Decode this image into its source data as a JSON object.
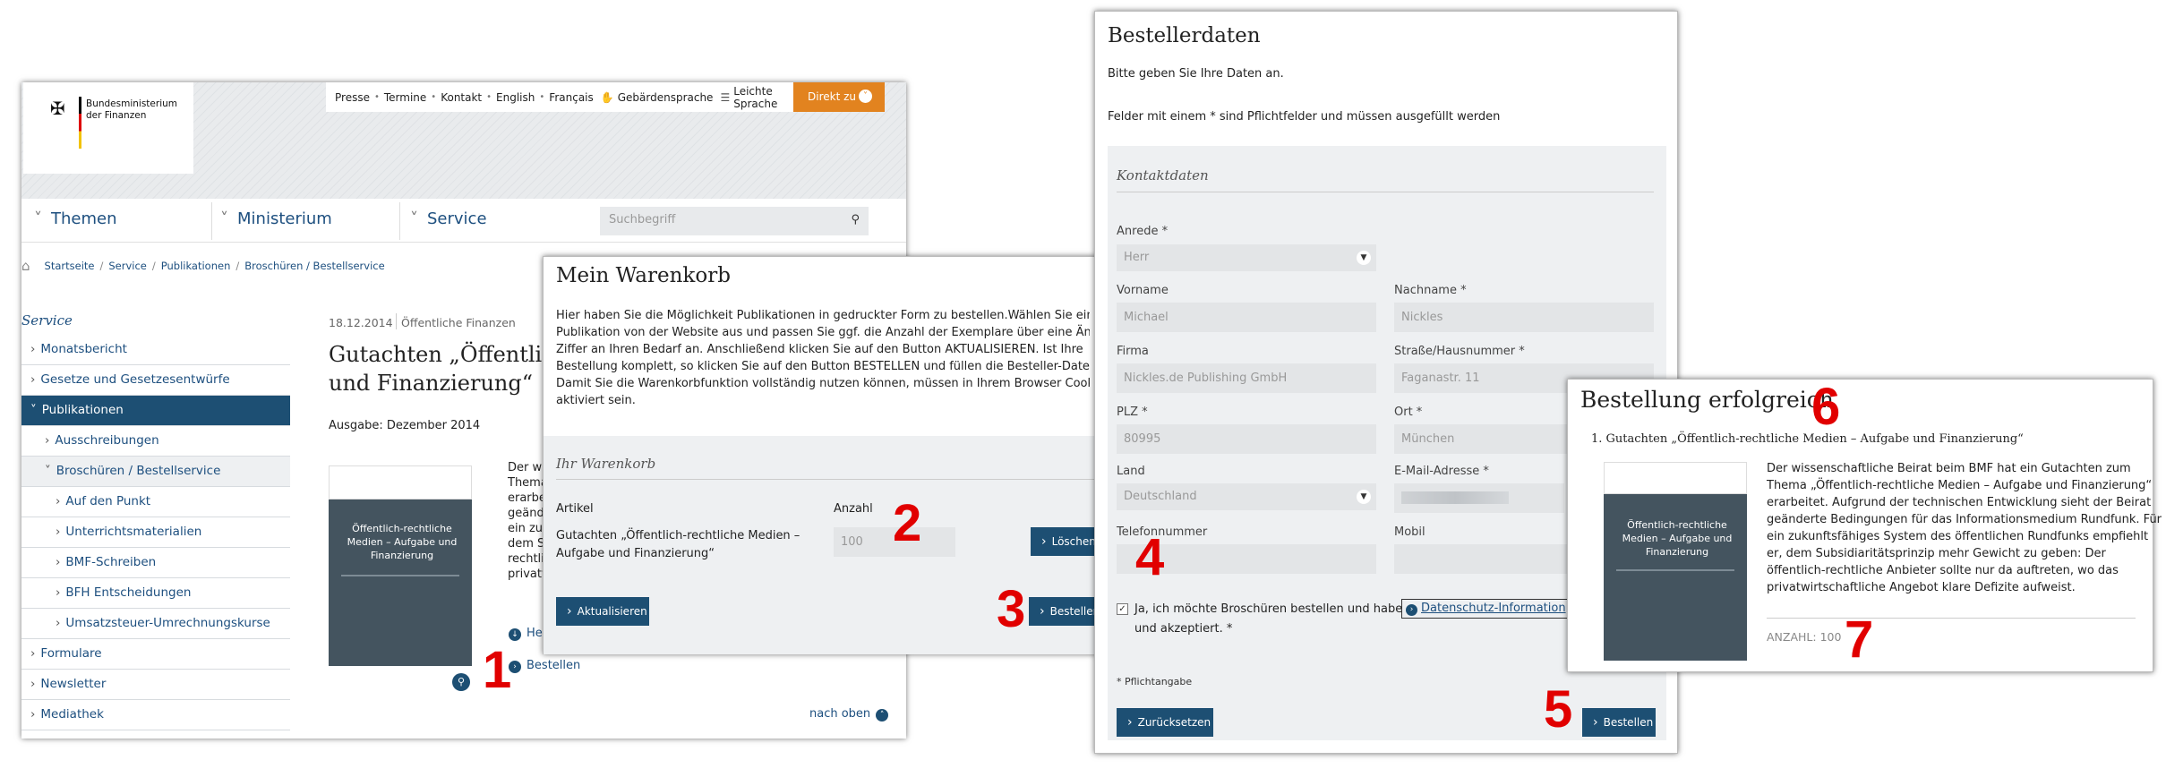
{
  "bmf": {
    "logo_line1": "Bundesministerium",
    "logo_line2": "der Finanzen",
    "topnav": [
      "Presse",
      "Termine",
      "Kontakt",
      "English",
      "Français",
      "Gebärdensprache",
      "Leichte Sprache"
    ],
    "direkt": "Direkt zu",
    "mainnav": [
      "Themen",
      "Ministerium",
      "Service"
    ],
    "search_placeholder": "Suchbegriff",
    "breadcrumb": [
      "Startseite",
      "Service",
      "Publikationen",
      "Broschüren / Bestellservice"
    ],
    "sidebar_title": "Service",
    "sidebar": [
      "Monatsbericht",
      "Gesetze und Gesetzesentwürfe",
      "Publikationen",
      "Ausschreibungen",
      "Broschüren / Bestellservice",
      "Auf den Punkt",
      "Unterrichtsmaterialien",
      "BMF-Schreiben",
      "BFH Entscheidungen",
      "Umsatzsteuer-Umrechnungskurse",
      "Formulare",
      "Newsletter",
      "Mediathek"
    ],
    "date": "18.12.2014",
    "category": "Öffentliche Finanzen",
    "title_line1": "Gutachten „Öffentlich",
    "title_line2": "und Finanzierung“",
    "ausgabe": "Ausgabe: Dezember 2014",
    "body_frags": [
      "Der wis",
      "Thema",
      "erarbei",
      "geände",
      "ein zuk",
      "dem Su",
      "rechtlic",
      "privatw"
    ],
    "herunterladen": "Her",
    "bestellen": "Bestellen",
    "nach_oben": "nach oben",
    "cover_title": "Öffentlich-rechtliche Medien – Aufgabe und Finanzierung"
  },
  "cart": {
    "title": "Mein Warenkorb",
    "intro": [
      "Hier haben Sie die Möglichkeit Publikationen in gedruckter Form zu bestellen.Wählen Sie einfach ein",
      "Publikation von der Website aus und passen Sie ggf. die Anzahl der Exemplare über eine Änderung d",
      "Ziffer an Ihren Bedarf an. Anschließend klicken Sie auf den Button AKTUALISIEREN. Ist Ihre",
      "Bestellung komplett, so klicken Sie auf den Button BESTELLEN und füllen die Besteller-Daten aus.",
      "Damit Sie die Warenkorbfunktion vollständig nutzen können, müssen in Ihrem Browser Cookies",
      "aktiviert sein."
    ],
    "section": "Ihr Warenkorb",
    "col_article": "Artikel",
    "col_qty": "Anzahl",
    "item_line1": "Gutachten „Öffentlich-rechtliche Medien –",
    "item_line2": "Aufgabe und Finanzierung“",
    "qty": "100",
    "delete": "Löschen",
    "update": "Aktualisieren",
    "order": "Bestellen"
  },
  "form": {
    "title": "Bestellerdaten",
    "intro": "Bitte geben Sie Ihre Daten an.",
    "required_note": "Felder mit einem * sind Pflichtfelder und müssen ausgefüllt werden",
    "section": "Kontaktdaten",
    "anrede_label": "Anrede *",
    "anrede": "Herr",
    "vorname_label": "Vorname",
    "vorname": "Michael",
    "nachname_label": "Nachname *",
    "nachname": "Nickles",
    "firma_label": "Firma",
    "firma": "Nickles.de Publishing GmbH",
    "strasse_label": "Straße/Hausnummer *",
    "strasse": "Faganastr. 11",
    "plz_label": "PLZ *",
    "plz": "80995",
    "ort_label": "Ort *",
    "ort": "München",
    "land_label": "Land",
    "land": "Deutschland",
    "email_label": "E-Mail-Adresse *",
    "telefon_label": "Telefonnummer",
    "mobil_label": "Mobil",
    "consent1": "Ja, ich möchte Broschüren bestellen und habe die",
    "consent_link": "Datenschutz-Information",
    "consent2": "und akzeptiert. *",
    "pflicht": "* Pflichtangabe",
    "reset": "Zurücksetzen",
    "order": "Bestellen"
  },
  "success": {
    "title": "Bestellung erfolgreich",
    "item": "1. Gutachten „Öffentlich-rechtliche Medien – Aufgabe und Finanzierung“",
    "desc": [
      "Der wissenschaftliche Beirat beim BMF hat ein Gutachten zum",
      "Thema „Öffentlich-rechtliche Medien – Aufgabe und Finanzierung“",
      "erarbeitet. Aufgrund der technischen Entwicklung sieht der Beirat",
      "geänderte Bedingungen für das Informationsmedium Rundfunk. Für",
      "ein zukunftsfähiges System des öffentlichen Rundfunks empfiehlt",
      "er, dem Subsidiaritätsprinzip mehr Gewicht zu geben: Der",
      "öffentlich-rechtliche Anbieter sollte nur da auftreten, wo das",
      "privatwirtschaftliche Angebot klare Defizite aufweist."
    ],
    "anzahl": "ANZAHL: 100"
  },
  "steps": [
    "1",
    "2",
    "3",
    "4",
    "5",
    "6",
    "7"
  ],
  "colors": {
    "accent_blue": "#1d4f73",
    "orange": "#e2831f",
    "step_red": "#e10000"
  }
}
